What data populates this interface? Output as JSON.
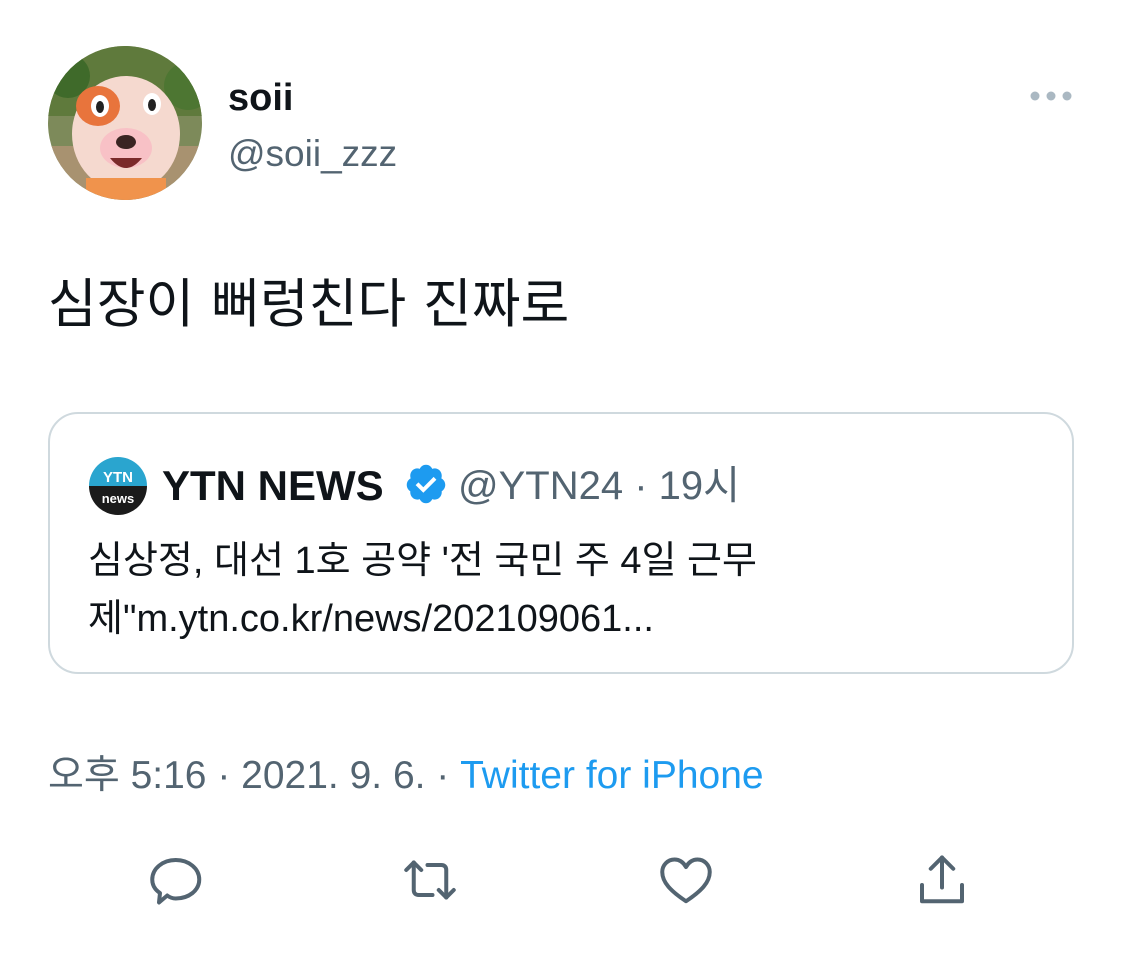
{
  "author": {
    "display_name": "soii",
    "handle": "@soii_zzz"
  },
  "tweet": {
    "text": "심장이 뻐렁친다 진짜로"
  },
  "quoted_tweet": {
    "avatar_text_top": "YTN",
    "avatar_text_bottom": "news",
    "display_name": "YTN NEWS",
    "handle_and_time": "@YTN24 · 19시",
    "text": "심상정, 대선 1호 공약 '전 국민 주 4일 근무제\"m.ytn.co.kr/news/202109061..."
  },
  "meta": {
    "timestamp": "오후 5:16 · 2021. 9. 6. · ",
    "source": "Twitter for iPhone"
  },
  "icons": {
    "more": "more-dots-icon",
    "verified": "verified-badge-icon",
    "reply": "reply-icon",
    "retweet": "retweet-icon",
    "like": "like-icon",
    "share": "share-icon"
  },
  "colors": {
    "link": "#1d9bf0",
    "secondary_text": "#536471",
    "border": "#cfd9de"
  }
}
